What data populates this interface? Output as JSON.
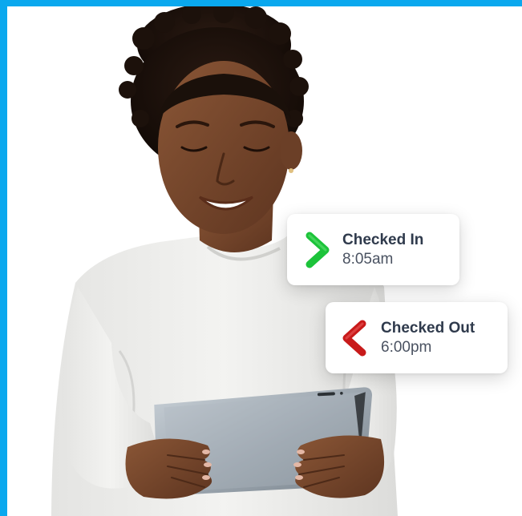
{
  "colors": {
    "frame": "#0aa8ee",
    "background": "#ffffff",
    "checked_in": "#1cc33a",
    "checked_out": "#c81a1a",
    "title_text": "#2f3a4c",
    "time_text": "#4a5261"
  },
  "photo": {
    "subject": "woman smiling while holding a tablet"
  },
  "checked_in": {
    "icon": "chevron-right-icon",
    "label": "Checked In",
    "time": "8:05am"
  },
  "checked_out": {
    "icon": "chevron-left-icon",
    "label": "Checked Out",
    "time": "6:00pm"
  }
}
